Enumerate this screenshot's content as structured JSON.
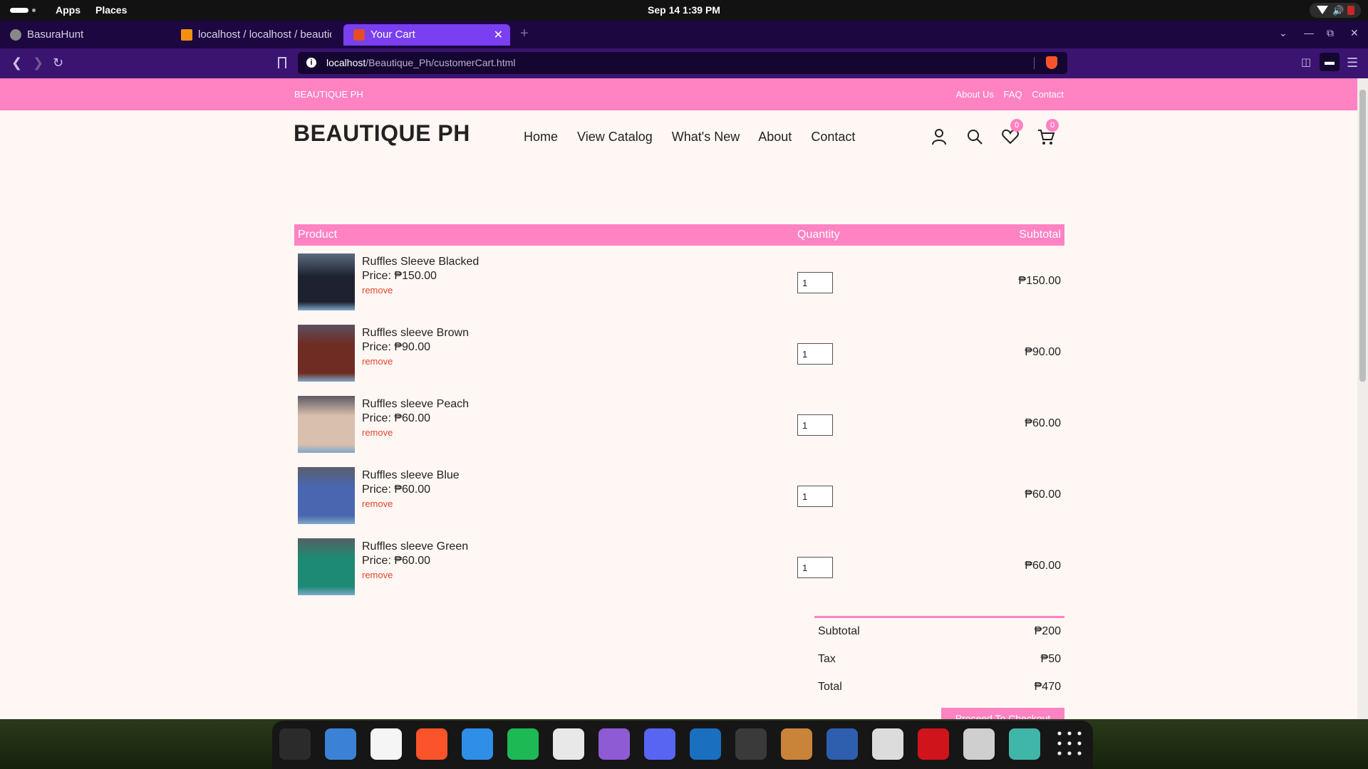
{
  "system": {
    "apps_label": "Apps",
    "places_label": "Places",
    "clock": "Sep 14   1:39 PM"
  },
  "browser": {
    "tabs": [
      {
        "label": "BasuraHunt",
        "icon": "globe-icon"
      },
      {
        "label": "localhost / localhost / beautique",
        "icon": "phpmyadmin-icon"
      },
      {
        "label": "Your Cart",
        "icon": "html-icon"
      }
    ],
    "url_host": "localhost",
    "url_path": "/Beautique_Ph/customerCart.html"
  },
  "site": {
    "top_brand": "BEAUTIQUE PH",
    "top_links": [
      "About Us",
      "FAQ",
      "Contact"
    ],
    "logo": "BEAUTIQUE PH",
    "menu": [
      "Home",
      "View Catalog",
      "What's New",
      "About",
      "Contact"
    ],
    "wishlist_count": "0",
    "cart_count": "0"
  },
  "cart": {
    "headers": {
      "product": "Product",
      "quantity": "Quantity",
      "subtotal": "Subtotal"
    },
    "items": [
      {
        "name": "Ruffles Sleeve Blacked",
        "price": "Price: ₱150.00",
        "remove": "remove",
        "qty": "1",
        "subtotal": "₱150.00",
        "color": "#1e2230"
      },
      {
        "name": "Ruffles sleeve Brown",
        "price": "Price: ₱90.00",
        "remove": "remove",
        "qty": "1",
        "subtotal": "₱90.00",
        "color": "#6e2c22"
      },
      {
        "name": "Ruffles sleeve Peach",
        "price": "Price: ₱60.00",
        "remove": "remove",
        "qty": "1",
        "subtotal": "₱60.00",
        "color": "#d9bfae"
      },
      {
        "name": "Ruffles sleeve Blue",
        "price": "Price: ₱60.00",
        "remove": "remove",
        "qty": "1",
        "subtotal": "₱60.00",
        "color": "#4a66b0"
      },
      {
        "name": "Ruffles sleeve Green",
        "price": "Price: ₱60.00",
        "remove": "remove",
        "qty": "1",
        "subtotal": "₱60.00",
        "color": "#1d8a75"
      }
    ],
    "totals": [
      {
        "label": "Subtotal",
        "value": "₱200"
      },
      {
        "label": "Tax",
        "value": "₱50"
      },
      {
        "label": "Total",
        "value": "₱470"
      }
    ],
    "checkout_label": "Proceed To Checkout"
  },
  "colors": {
    "accent_pink": "#ff82c3",
    "remove_red": "#e2452f",
    "page_bg": "#fff7f3",
    "browser_purple": "#3a1470"
  },
  "dock": [
    {
      "name": "terminal-app",
      "color": "#2b2b2b"
    },
    {
      "name": "files-app",
      "color": "#3b82d6"
    },
    {
      "name": "text-editor-app",
      "color": "#f5f5f5"
    },
    {
      "name": "brave-app",
      "color": "#fb542b"
    },
    {
      "name": "vscode-app",
      "color": "#2f8ee8"
    },
    {
      "name": "spotify-app",
      "color": "#1db954"
    },
    {
      "name": "github-app",
      "color": "#e8e8e8"
    },
    {
      "name": "github-desktop-app",
      "color": "#8e5bd4"
    },
    {
      "name": "discord-app",
      "color": "#5865f2"
    },
    {
      "name": "steam-app",
      "color": "#1b6fbf"
    },
    {
      "name": "obs-app",
      "color": "#3a3a3a"
    },
    {
      "name": "game-app",
      "color": "#c9843a"
    },
    {
      "name": "kdenlive-app",
      "color": "#2d5fae"
    },
    {
      "name": "inkscape-app",
      "color": "#dcdcdc"
    },
    {
      "name": "acrobat-app",
      "color": "#d0141b"
    },
    {
      "name": "settings-app",
      "color": "#cfcfcf"
    },
    {
      "name": "android-studio-app",
      "color": "#3fb6a8"
    },
    {
      "name": "app-grid",
      "color": "#161616"
    }
  ]
}
